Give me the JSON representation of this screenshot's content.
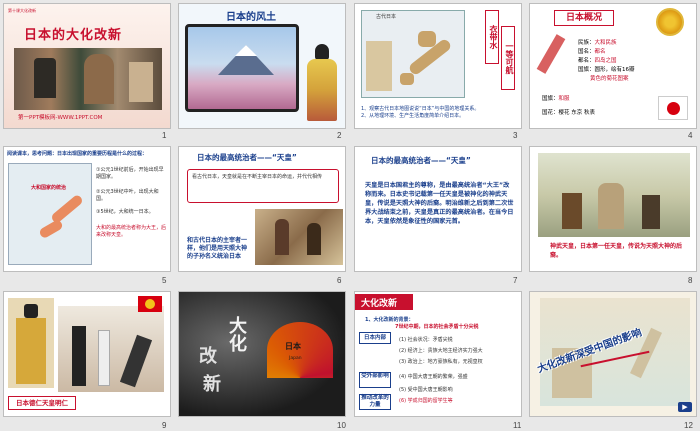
{
  "slides": [
    {
      "num": "1",
      "title": "日本的大化改新",
      "top_tag": "第十课大化改新",
      "footer": "第一PPT模板网-WWW.1PPT.COM"
    },
    {
      "num": "2",
      "title": "日本的风土"
    },
    {
      "num": "3",
      "vertical1": "衣带水",
      "vertical2": "一等可航",
      "map_title": "古代日本",
      "line1": "1、观察古代日本地图说说“日本”与中国的地理关系。",
      "line2": "2、从地理环境、生产生活角度简单介绍日本。"
    },
    {
      "num": "4",
      "title": "日本概况",
      "rows": [
        {
          "k": "民族：",
          "v": "大和民族"
        },
        {
          "k": "国名：",
          "v": "都名"
        },
        {
          "k": "都名：",
          "v": "四岛之国"
        },
        {
          "k": "国旗：",
          "v": "圆形，绘有16瓣"
        },
        {
          "k": "",
          "v": "黄色的菊花图案"
        }
      ],
      "bottom_k": "国旗：",
      "bottom_v": "和服",
      "last": "国花：樱花 东京 秋表"
    },
    {
      "num": "5",
      "heading": "阅读课本，思考问题：日本出现国家的重要历程是什么的过程：",
      "map_label": "大和国家的统治",
      "items": [
        "①公元1世纪前后，开始出现早期国家。",
        "②公元3世纪中叶，出现大和国。",
        "③5世纪，大和统一日本。",
        "大和的最高统治者称为大王，后来改称天皇。"
      ]
    },
    {
      "num": "6",
      "title": "日本的最高统治者——“天皇”",
      "text": "看古代日本，天皇就是在不断主宰日本的命运，并代代相传",
      "bottom": "和古代日本的主宰者一样，他们是用天照大神的子孙名义统治日本"
    },
    {
      "num": "7",
      "title": "日本的最高统治者——“天皇”",
      "text": "天皇是日本国君主的尊称，是由最高统治者“大王”改称而来。日本史书记载第一任天皇是被神化的神武天皇，传说是天照大神的后裔。明治维新之后到第二次世界大战结束之前，天皇是真正的最高统治者。在当今日本，天皇依然是象征性的国家元首。"
    },
    {
      "num": "8",
      "caption": "神武天皇，日本第一任天皇，传说为天照大神的后裔。"
    },
    {
      "num": "9",
      "caption": "日本德仁天皇明仁"
    },
    {
      "num": "10",
      "char1": "大化",
      "char2": "改",
      "char3": "新",
      "fan_text": "日本",
      "fan_sub": "Japan"
    },
    {
      "num": "11",
      "title": "大化改新",
      "sub": "1、大化改新的背景：",
      "labels": [
        "日本内部",
        "受外部影响",
        "推动改革的力量"
      ],
      "points": [
        "7世纪中期，日本的社会矛盾十分尖锐",
        "(1) 社会状况：矛盾尖锐",
        "(2) 经济上：贵族大地主经济实力强大",
        "(3) 政治上：地方豪族私有，无视皇权",
        "(4) 中国大唐王朝的繁荣，强盛",
        "(5) 受中国大唐王朝影响",
        "(6) 学成归国的留学生等"
      ]
    },
    {
      "num": "12",
      "title": "大化改新深受中国的影响"
    }
  ]
}
